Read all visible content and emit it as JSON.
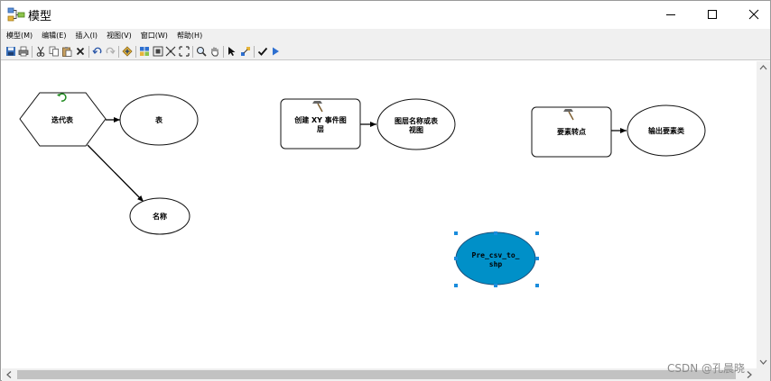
{
  "window": {
    "title": "模型",
    "icon": "model-icon"
  },
  "menu": [
    {
      "label": "模型(M)"
    },
    {
      "label": "编辑(E)"
    },
    {
      "label": "插入(I)"
    },
    {
      "label": "视图(V)"
    },
    {
      "label": "窗口(W)"
    },
    {
      "label": "帮助(H)"
    }
  ],
  "toolbar": {
    "icons": [
      "save-icon",
      "print-icon",
      "cut-icon",
      "copy-icon",
      "paste-icon",
      "delete-icon",
      "undo-icon",
      "redo-icon",
      "add-data-icon",
      "auto-layout-icon",
      "full-extent-icon",
      "select-all-icon",
      "fixed-zoom-icon",
      "zoom-icon",
      "pan-icon",
      "select-icon",
      "connect-icon",
      "validate-icon",
      "run-icon"
    ]
  },
  "diagram": {
    "iterator": {
      "label": "迭代表",
      "color": "#ffffff"
    },
    "table_output": {
      "label": "表"
    },
    "name_output": {
      "label": "名称"
    },
    "create_xy_tool": {
      "label_line1": "创建 XY 事件图",
      "label_line2": "层"
    },
    "layer_view_output": {
      "label_line1": "图层名称或表",
      "label_line2": "视图"
    },
    "feature_to_point_tool": {
      "label": "要素转点"
    },
    "output_features": {
      "label": "输出要素类"
    },
    "selected_model": {
      "label_line1": "Pre_csv_to_",
      "label_line2": "shp",
      "fill": "#0090c8"
    }
  },
  "watermark": "CSDN @孔晨晓"
}
